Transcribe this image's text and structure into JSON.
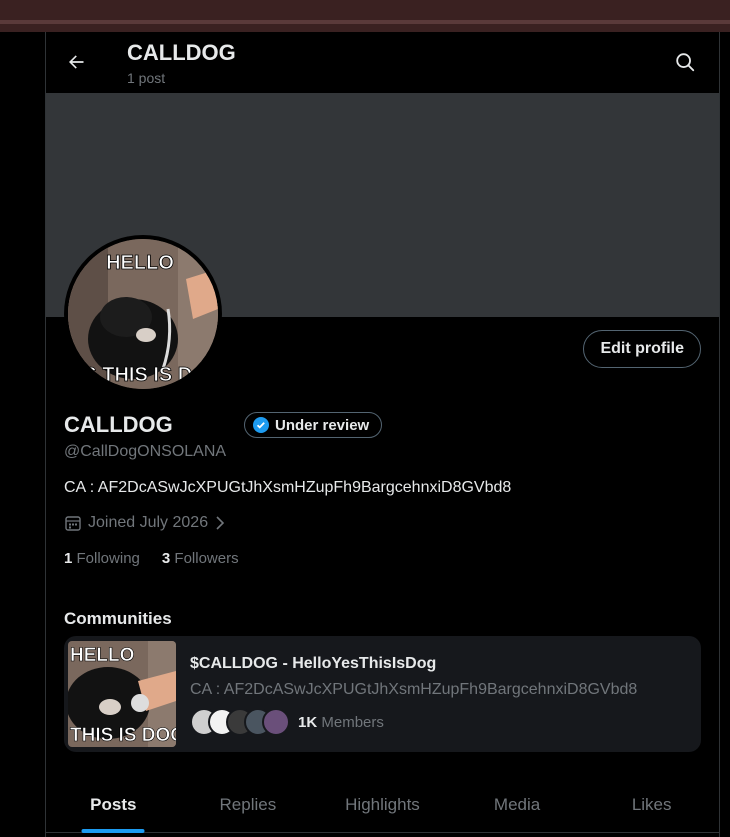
{
  "header": {
    "title": "CALLDOG",
    "post_count": "1 post"
  },
  "avatar": {
    "text_top": "HELLO",
    "text_bottom": "YES THIS IS DOG"
  },
  "profile": {
    "name": "CALLDOG",
    "handle": "@CallDogONSOLANA",
    "verification_label": "Under review",
    "bio": "CA : AF2DcASwJcXPUGtJhXsmHZupFh9BargcehnxiD8GVbd8",
    "joined": "Joined July 2026",
    "edit_label": "Edit profile",
    "following_count": "1",
    "following_label": "Following",
    "followers_count": "3",
    "followers_label": "Followers"
  },
  "communities": {
    "heading": "Communities",
    "card": {
      "title": "$CALLDOG - HelloYesThisIsDog",
      "description": "CA : AF2DcASwJcXPUGtJhXsmHZupFh9BargcehnxiD8GVbd8",
      "members_count": "1K",
      "members_label": "Members",
      "image_text_top": "HELLO",
      "image_text_bottom": "THIS IS DOG"
    }
  },
  "tabs": [
    {
      "label": "Posts",
      "active": true
    },
    {
      "label": "Replies",
      "active": false
    },
    {
      "label": "Highlights",
      "active": false
    },
    {
      "label": "Media",
      "active": false
    },
    {
      "label": "Likes",
      "active": false
    }
  ],
  "colors": {
    "background": "#000000",
    "banner": "#333639",
    "accent": "#1d9bf0",
    "muted_text": "#71767b",
    "card_bg": "#16181c",
    "window_frame": "#3a2121"
  }
}
